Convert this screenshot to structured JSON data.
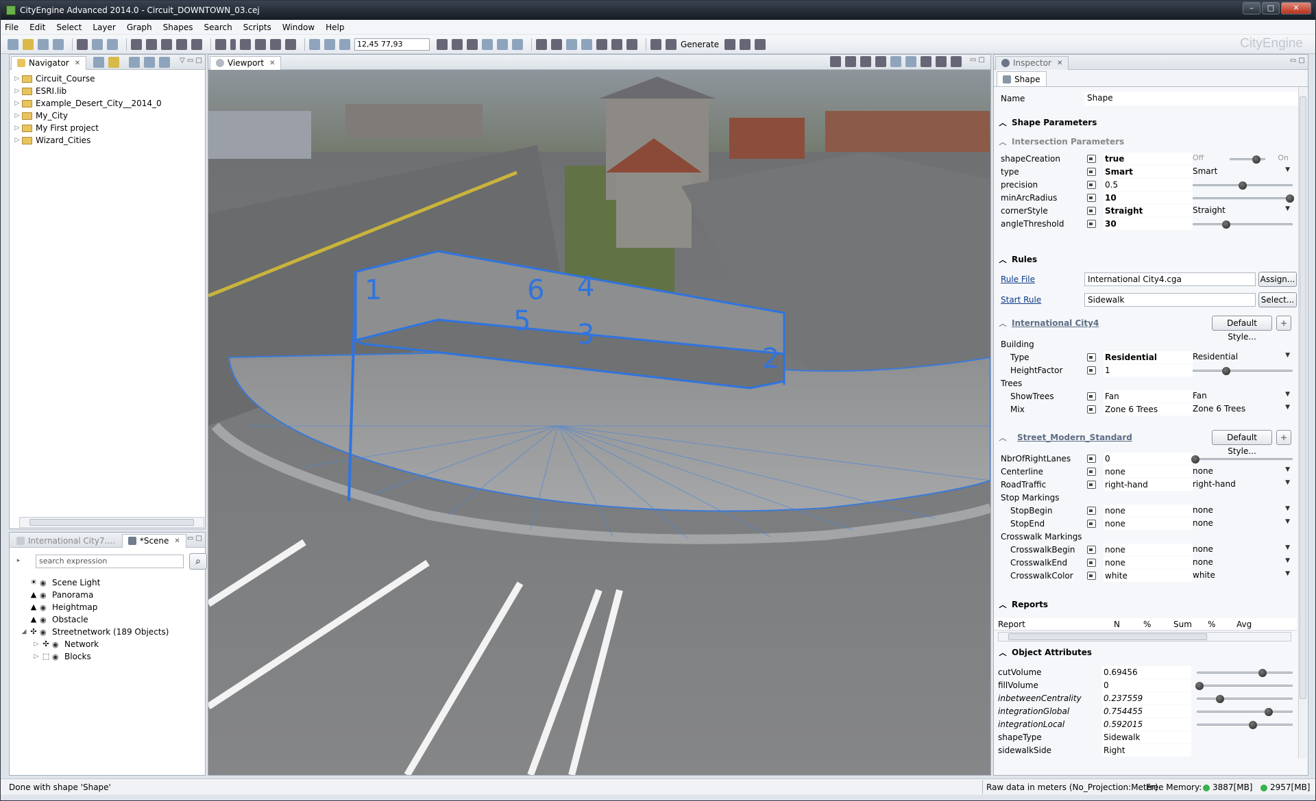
{
  "window": {
    "title": "CityEngine Advanced 2014.0 - Circuit_DOWNTOWN_03.cej",
    "brand": "CityEngine"
  },
  "menu": [
    "File",
    "Edit",
    "Select",
    "Layer",
    "Graph",
    "Shapes",
    "Search",
    "Scripts",
    "Window",
    "Help"
  ],
  "toolbar": {
    "coord": "12,45 77,93",
    "generate_label": "Generate"
  },
  "navigator": {
    "tab": "Navigator",
    "items": [
      "Circuit_Course",
      "ESRI.lib",
      "Example_Desert_City__2014_0",
      "My_City",
      "My First project",
      "Wizard_Cities"
    ]
  },
  "scene_panel": {
    "tab_inactive": "International City7....",
    "tab_active": "*Scene",
    "search_placeholder": "search expression",
    "items": [
      {
        "label": "Scene Light",
        "icon": "sun-icon"
      },
      {
        "label": "Panorama",
        "icon": "mountain-icon"
      },
      {
        "label": "Heightmap",
        "icon": "mountain-icon"
      },
      {
        "label": "Obstacle",
        "icon": "mountain-icon"
      },
      {
        "label": "Streetnetwork (189 Objects)",
        "icon": "network-icon"
      },
      {
        "label": "Network",
        "icon": "network-icon"
      },
      {
        "label": "Blocks",
        "icon": "blocks-icon"
      }
    ]
  },
  "viewport": {
    "tab": "Viewport",
    "labels": [
      "1",
      "2",
      "3",
      "4",
      "5",
      "6"
    ]
  },
  "inspector": {
    "tab": "Inspector",
    "subtab": "Shape",
    "name_label": "Name",
    "name_value": "Shape",
    "shape_params": {
      "header": "Shape Parameters",
      "subheader": "Intersection Parameters",
      "rows": [
        {
          "label": "shapeCreation",
          "value": "true",
          "bold": true,
          "ctrl": "toggle",
          "off": "Off",
          "on": "On",
          "level": 0.75
        },
        {
          "label": "type",
          "value": "Smart",
          "bold": true,
          "ctrl": "dropdown",
          "choice": "Smart"
        },
        {
          "label": "precision",
          "value": "0.5",
          "bold": false,
          "ctrl": "slider",
          "level": 0.5
        },
        {
          "label": "minArcRadius",
          "value": "10",
          "bold": true,
          "ctrl": "slider",
          "level": 0.98
        },
        {
          "label": "cornerStyle",
          "value": "Straight",
          "bold": true,
          "ctrl": "dropdown",
          "choice": "Straight"
        },
        {
          "label": "angleThreshold",
          "value": "30",
          "bold": true,
          "ctrl": "slider",
          "level": 0.33
        }
      ]
    },
    "rules": {
      "header": "Rules",
      "rule_file_label": "Rule File",
      "rule_file_value": "International City4.cga",
      "assign_btn": "Assign...",
      "start_rule_label": "Start Rule",
      "start_rule_value": "Sidewalk",
      "select_btn": "Select..."
    },
    "intl_city": {
      "header": "International City4",
      "default_btn": "Default Style...",
      "group1": "Building",
      "group2": "Trees",
      "rows": [
        {
          "label": "Type",
          "value": "Residential",
          "bold": true,
          "ctrl": "dropdown",
          "choice": "Residential"
        },
        {
          "label": "HeightFactor",
          "value": "1",
          "bold": false,
          "ctrl": "slider",
          "level": 0.33
        },
        {
          "label": "ShowTrees",
          "value": "Fan",
          "bold": false,
          "ctrl": "dropdown",
          "choice": "Fan"
        },
        {
          "label": "Mix",
          "value": "Zone 6 Trees",
          "bold": false,
          "ctrl": "dropdown",
          "choice": "Zone 6 Trees"
        }
      ]
    },
    "street": {
      "header": "Street_Modern_Standard",
      "default_btn": "Default Style...",
      "group_stop": "Stop Markings",
      "group_cross": "Crosswalk Markings",
      "rows": [
        {
          "label": "NbrOfRightLanes",
          "value": "0",
          "ctrl": "slider",
          "level": 0.02
        },
        {
          "label": "Centerline",
          "value": "none",
          "ctrl": "dropdown",
          "choice": "none"
        },
        {
          "label": "RoadTraffic",
          "value": "right-hand",
          "ctrl": "dropdown",
          "choice": "right-hand"
        },
        {
          "label": "StopBegin",
          "value": "none",
          "ctrl": "dropdown",
          "choice": "none"
        },
        {
          "label": "StopEnd",
          "value": "none",
          "ctrl": "dropdown",
          "choice": "none"
        },
        {
          "label": "CrosswalkBegin",
          "value": "none",
          "ctrl": "dropdown",
          "choice": "none"
        },
        {
          "label": "CrosswalkEnd",
          "value": "none",
          "ctrl": "dropdown",
          "choice": "none"
        },
        {
          "label": "CrosswalkColor",
          "value": "white",
          "ctrl": "dropdown",
          "choice": "white"
        }
      ]
    },
    "reports": {
      "header": "Reports",
      "columns": [
        "Report",
        "N",
        "%",
        "Sum",
        "%",
        "Avg"
      ]
    },
    "object_attrs": {
      "header": "Object Attributes",
      "rows": [
        {
          "label": "cutVolume",
          "value": "0.69456",
          "italic": false,
          "level": 0.69
        },
        {
          "label": "fillVolume",
          "value": "0",
          "italic": false,
          "level": 0.02
        },
        {
          "label": "inbetweenCentrality",
          "value": "0.237559",
          "italic": true,
          "level": 0.24
        },
        {
          "label": "integrationGlobal",
          "value": "0.754455",
          "italic": true,
          "level": 0.75
        },
        {
          "label": "integrationLocal",
          "value": "0.592015",
          "italic": true,
          "level": 0.59
        },
        {
          "label": "shapeType",
          "value": "Sidewalk",
          "italic": false,
          "level": null
        },
        {
          "label": "sidewalkSide",
          "value": "Right",
          "italic": false,
          "level": null
        }
      ]
    }
  },
  "status": {
    "left": "Done with shape 'Shape'",
    "projection": "Raw data in meters (No_Projection:Meter)",
    "mem_label": "Free Memory:",
    "mem1": "3887[MB]",
    "mem2": "2957[MB]"
  }
}
